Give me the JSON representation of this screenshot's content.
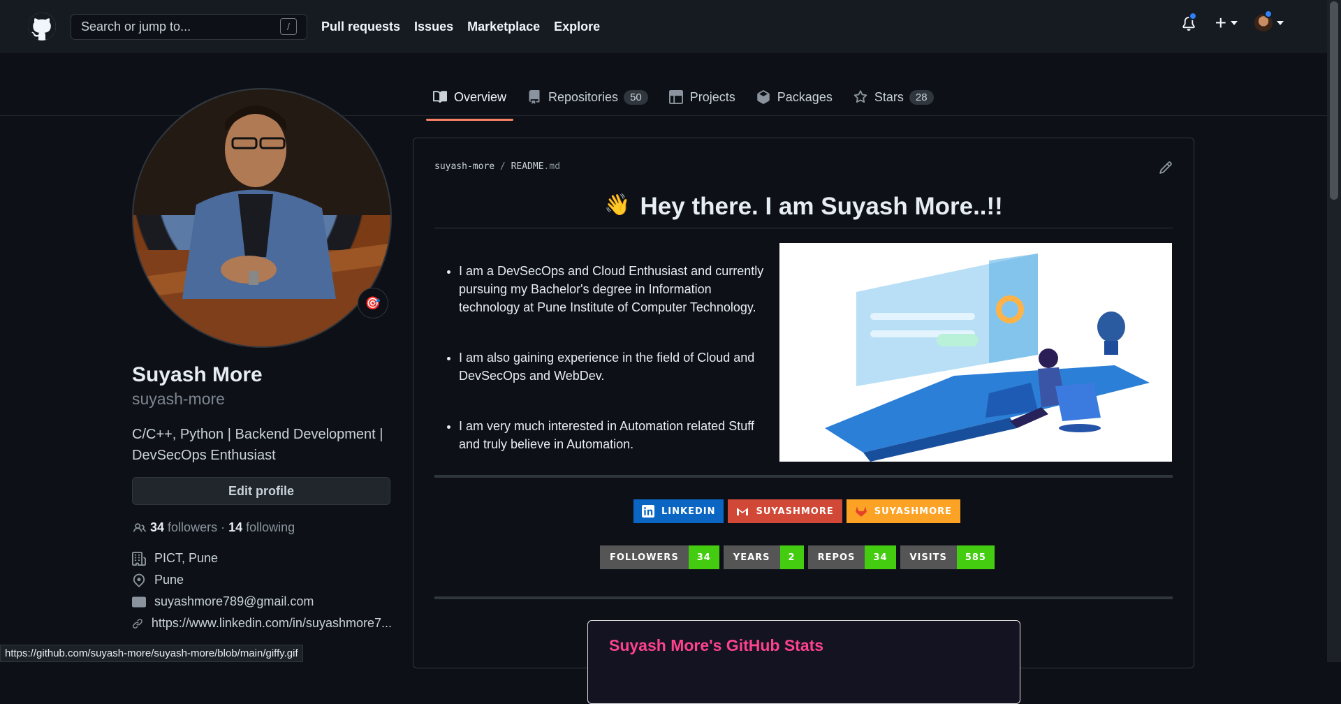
{
  "header": {
    "search_placeholder": "Search or jump to...",
    "search_shortcut": "/",
    "nav": [
      "Pull requests",
      "Issues",
      "Marketplace",
      "Explore"
    ],
    "plus": "+"
  },
  "tabs": [
    {
      "label": "Overview",
      "count": null,
      "active": true
    },
    {
      "label": "Repositories",
      "count": "50",
      "active": false
    },
    {
      "label": "Projects",
      "count": null,
      "active": false
    },
    {
      "label": "Packages",
      "count": null,
      "active": false
    },
    {
      "label": "Stars",
      "count": "28",
      "active": false
    }
  ],
  "profile": {
    "status_emoji": "🎯",
    "name": "Suyash More",
    "username": "suyash-more",
    "bio": "C/C++, Python | Backend Development | DevSecOps Enthusiast",
    "edit_label": "Edit profile",
    "followers": "34",
    "followers_label": "followers",
    "following": "14",
    "following_label": "following",
    "separator": " · ",
    "company": "PICT, Pune",
    "location": "Pune",
    "email": "suyashmore789@gmail.com",
    "website": "https://www.linkedin.com/in/suyashmore7..."
  },
  "readme": {
    "owner": "suyash-more",
    "separator": "/",
    "file_base": "README",
    "file_ext": ".md",
    "emoji": "👋",
    "title": "Hey there. I am Suyash More..!!",
    "bullets": [
      "I am a DevSecOps and Cloud Enthusiast and currently pursuing my Bachelor's degree in Information technology at Pune Institute of Computer Technology.",
      "I am also gaining experience in the field of Cloud and DevSecOps and WebDev.",
      "I am very much interested in Automation related Stuff and truly believe in Automation."
    ],
    "social_badges": [
      {
        "label": "LINKEDIN",
        "color": "#0a66c2"
      },
      {
        "label": "SUYASHMORE",
        "color": "#d14836"
      },
      {
        "label": "SUYASHMORE",
        "color": "#fca326"
      }
    ],
    "stat_badges": [
      {
        "label": "FOLLOWERS",
        "value": "34"
      },
      {
        "label": "YEARS",
        "value": "2"
      },
      {
        "label": "REPOS",
        "value": "34"
      },
      {
        "label": "VISITS",
        "value": "585"
      }
    ],
    "stats_title": "Suyash More's GitHub Stats"
  },
  "status_url": "https://github.com/suyash-more/suyash-more/blob/main/giffy.gif",
  "colors": {
    "accent": "#f78166",
    "badge_green": "#44cc11",
    "stats_pink": "#fe428e"
  }
}
